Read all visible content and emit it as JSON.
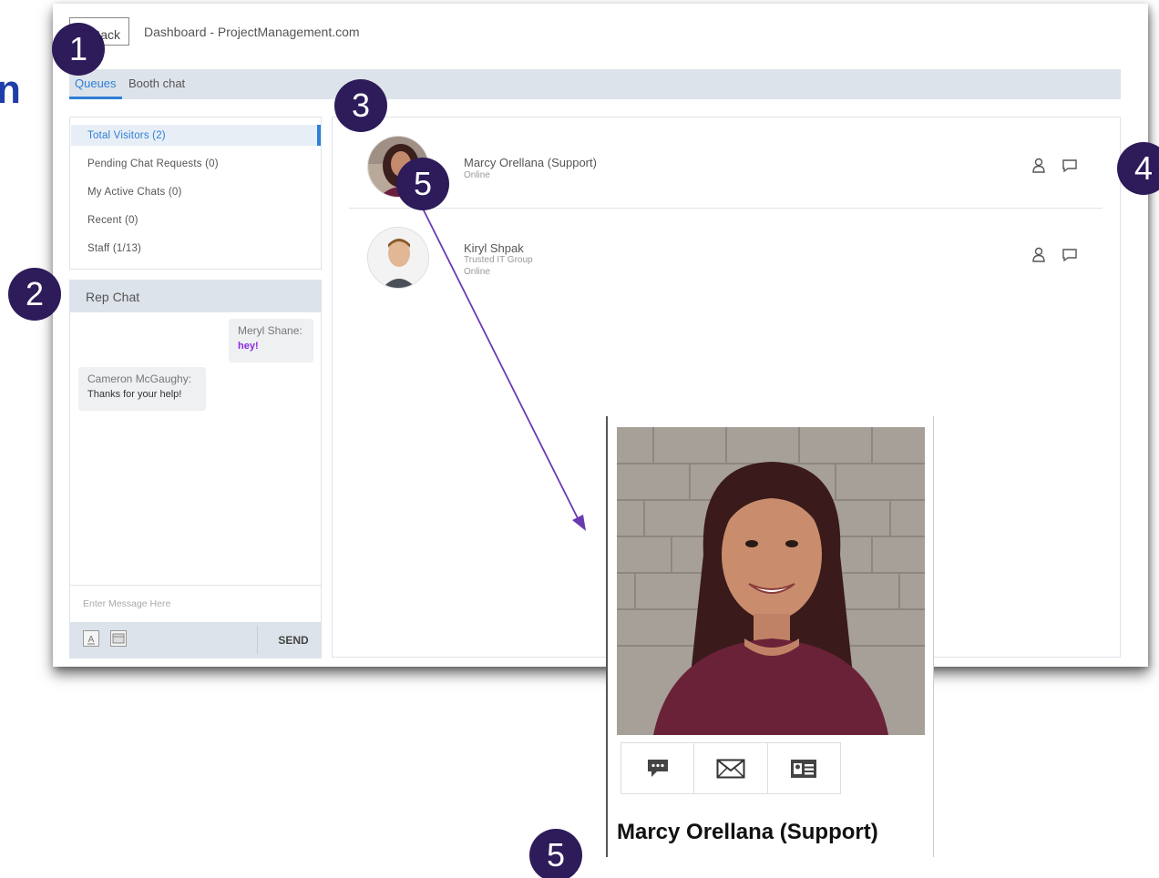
{
  "edge_glyph": "n",
  "window": {
    "back_label": "Back",
    "title": "Dashboard - ProjectManagement.com"
  },
  "tabs": [
    {
      "label": "Queues",
      "active": true
    },
    {
      "label": "Booth chat",
      "active": false
    }
  ],
  "queues": [
    {
      "label": "Total Visitors (2)",
      "active": true
    },
    {
      "label": "Pending Chat Requests (0)",
      "active": false
    },
    {
      "label": "My Active Chats (0)",
      "active": false
    },
    {
      "label": "Recent (0)",
      "active": false
    },
    {
      "label": "Staff (1/13)",
      "active": false
    }
  ],
  "rep_chat": {
    "header": "Rep Chat",
    "messages": [
      {
        "sender": "Meryl Shane:",
        "text": "hey!"
      },
      {
        "sender": "Cameron McGaughy:",
        "text": "Thanks for your help!"
      }
    ],
    "input_placeholder": "Enter Message Here",
    "footer_icons": [
      "font-icon",
      "image-icon"
    ],
    "send_label": "SEND"
  },
  "staff": [
    {
      "name": "Marcy Orellana (Support)",
      "subtitle": "",
      "status": "Online"
    },
    {
      "name": "Kiryl Shpak",
      "subtitle": "Trusted IT Group",
      "status": "Online"
    }
  ],
  "row_icons": [
    "person-icon",
    "chat-bubble-icon"
  ],
  "profile_card": {
    "name": "Marcy Orellana (Support)",
    "actions": [
      "chat-icon",
      "mail-icon",
      "contact-card-icon"
    ]
  },
  "badges": [
    "1",
    "2",
    "3",
    "4",
    "5",
    "5"
  ],
  "colors": {
    "accent": "#2f7fd6",
    "badge": "#2d1b5a",
    "panel_gray": "#dde3ea",
    "highlight_message": "#8a2be2",
    "arrow": "#6a3ab0"
  }
}
